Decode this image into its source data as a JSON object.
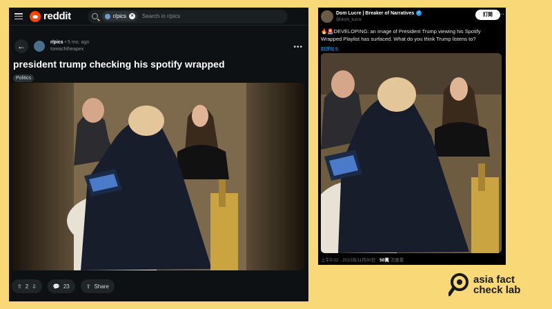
{
  "reddit": {
    "brand": "reddit",
    "search": {
      "community_chip": "r/pics",
      "placeholder": "Search in r/pics"
    },
    "post": {
      "subreddit": "r/pics",
      "age": "• 5 mo. ago",
      "username": "toreachtheapex",
      "title": "president trump checking his spotify wrapped",
      "flair": "Politics",
      "votes": "2",
      "comments": "23",
      "share_label": "Share"
    }
  },
  "tweet": {
    "display_name": "Dom Lucre | Breaker of Narratives",
    "handle": "@dom_lucre",
    "follow_label": "訂閱",
    "text": "🔥🚨DEVELOPING: an image of President Trump viewing his Spotify Wrapped Playlist has surfaced. What do you think Trump listens to?",
    "translate_label": "翻譯貼文",
    "timestamp": "上午9:02 · 2023年11月30日 · ",
    "views": "50萬",
    "views_label": " 次查看"
  },
  "logo": {
    "line1": "asia fact",
    "line2": "check lab"
  },
  "colors": {
    "background": "#f9d877",
    "reddit_orange": "#ff4500",
    "twitter_blue": "#1d9bf0"
  },
  "icons": [
    "hamburger-menu-icon",
    "search-icon",
    "back-arrow-icon",
    "upvote-icon",
    "downvote-icon",
    "comment-icon",
    "share-icon",
    "verified-badge-icon",
    "more-options-icon"
  ]
}
